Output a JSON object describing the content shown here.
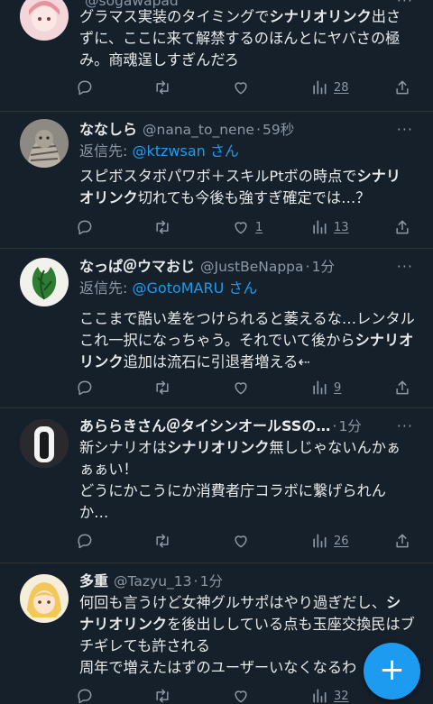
{
  "tweets": [
    {
      "name": "",
      "handle": "@sogawapad",
      "time": "",
      "reply_label": "",
      "reply_to": "",
      "text": [
        {
          "t": "グラマス実装のタイミングで",
          "b": false
        },
        {
          "t": "シナリオリンク",
          "b": true
        },
        {
          "t": "出さずに、ここに来て解禁するのほんとにヤバさの極み。商魂逞しすぎんだろ",
          "b": false
        }
      ],
      "counts": {
        "reply": "",
        "retweet": "",
        "like": "",
        "views": "28"
      }
    },
    {
      "name": "ななしら",
      "handle": "@nana_to_nene",
      "time": "59秒",
      "reply_label": "返信先:",
      "reply_to": "@ktzwsan",
      "reply_suffix": "さん",
      "text": [
        {
          "t": "スピボスタボパワボ＋スキルPtボの時点で",
          "b": false
        },
        {
          "t": "シナリオリンク",
          "b": true
        },
        {
          "t": "切れても今後も強すぎ確定では…？",
          "b": false
        }
      ],
      "counts": {
        "reply": "",
        "retweet": "",
        "like": "1",
        "views": "13"
      }
    },
    {
      "name": "なっぱ＠ウマおじ",
      "handle": "@JustBeNappa",
      "time": "1分",
      "reply_label": "返信先:",
      "reply_to": "@GotoMARU",
      "reply_suffix": "さん",
      "text": [
        {
          "t": "ここまで酷い差をつけられると萎えるな…レンタルこれ一択になっちゃう。それでいて後から",
          "b": false
        },
        {
          "t": "シナリオリンク",
          "b": true
        },
        {
          "t": "追加は流石に引退者増える⇠",
          "b": false
        }
      ],
      "counts": {
        "reply": "",
        "retweet": "",
        "like": "",
        "views": "9"
      }
    },
    {
      "name": "あららきさん＠タイシンオールSSの…",
      "handle": "",
      "time": "1分",
      "reply_label": "",
      "reply_to": "",
      "text": [
        {
          "t": "新シナリオは",
          "b": false
        },
        {
          "t": "シナリオリンク",
          "b": true
        },
        {
          "t": "無しじゃないんかぁぁぁい！\nどうにかこうにか消費者庁コラボに繋げられんか…",
          "b": false
        }
      ],
      "counts": {
        "reply": "",
        "retweet": "",
        "like": "",
        "views": "26"
      }
    },
    {
      "name": "多重",
      "handle": "@Tazyu_13",
      "time": "1分",
      "reply_label": "",
      "reply_to": "",
      "text": [
        {
          "t": "何回も言うけど女神グルサポはやり過ぎだし、",
          "b": false
        },
        {
          "t": "シナリオリンク",
          "b": true
        },
        {
          "t": "を後出ししている点も玉座交換民はブチギレても許される\n周年で増えたはずのユーザーいなくなるわ",
          "b": false
        }
      ],
      "counts": {
        "reply": "",
        "retweet": "",
        "like": "",
        "views": "32"
      }
    }
  ],
  "more_label": "···",
  "compose_label": "+",
  "colors": {
    "background": "#15202b",
    "accent": "#1d9bf0",
    "muted": "#8b98a5",
    "text": "#e7e9ea"
  },
  "icons": [
    "reply-icon",
    "retweet-icon",
    "like-icon",
    "views-icon",
    "share-icon",
    "more-icon",
    "compose-icon"
  ]
}
